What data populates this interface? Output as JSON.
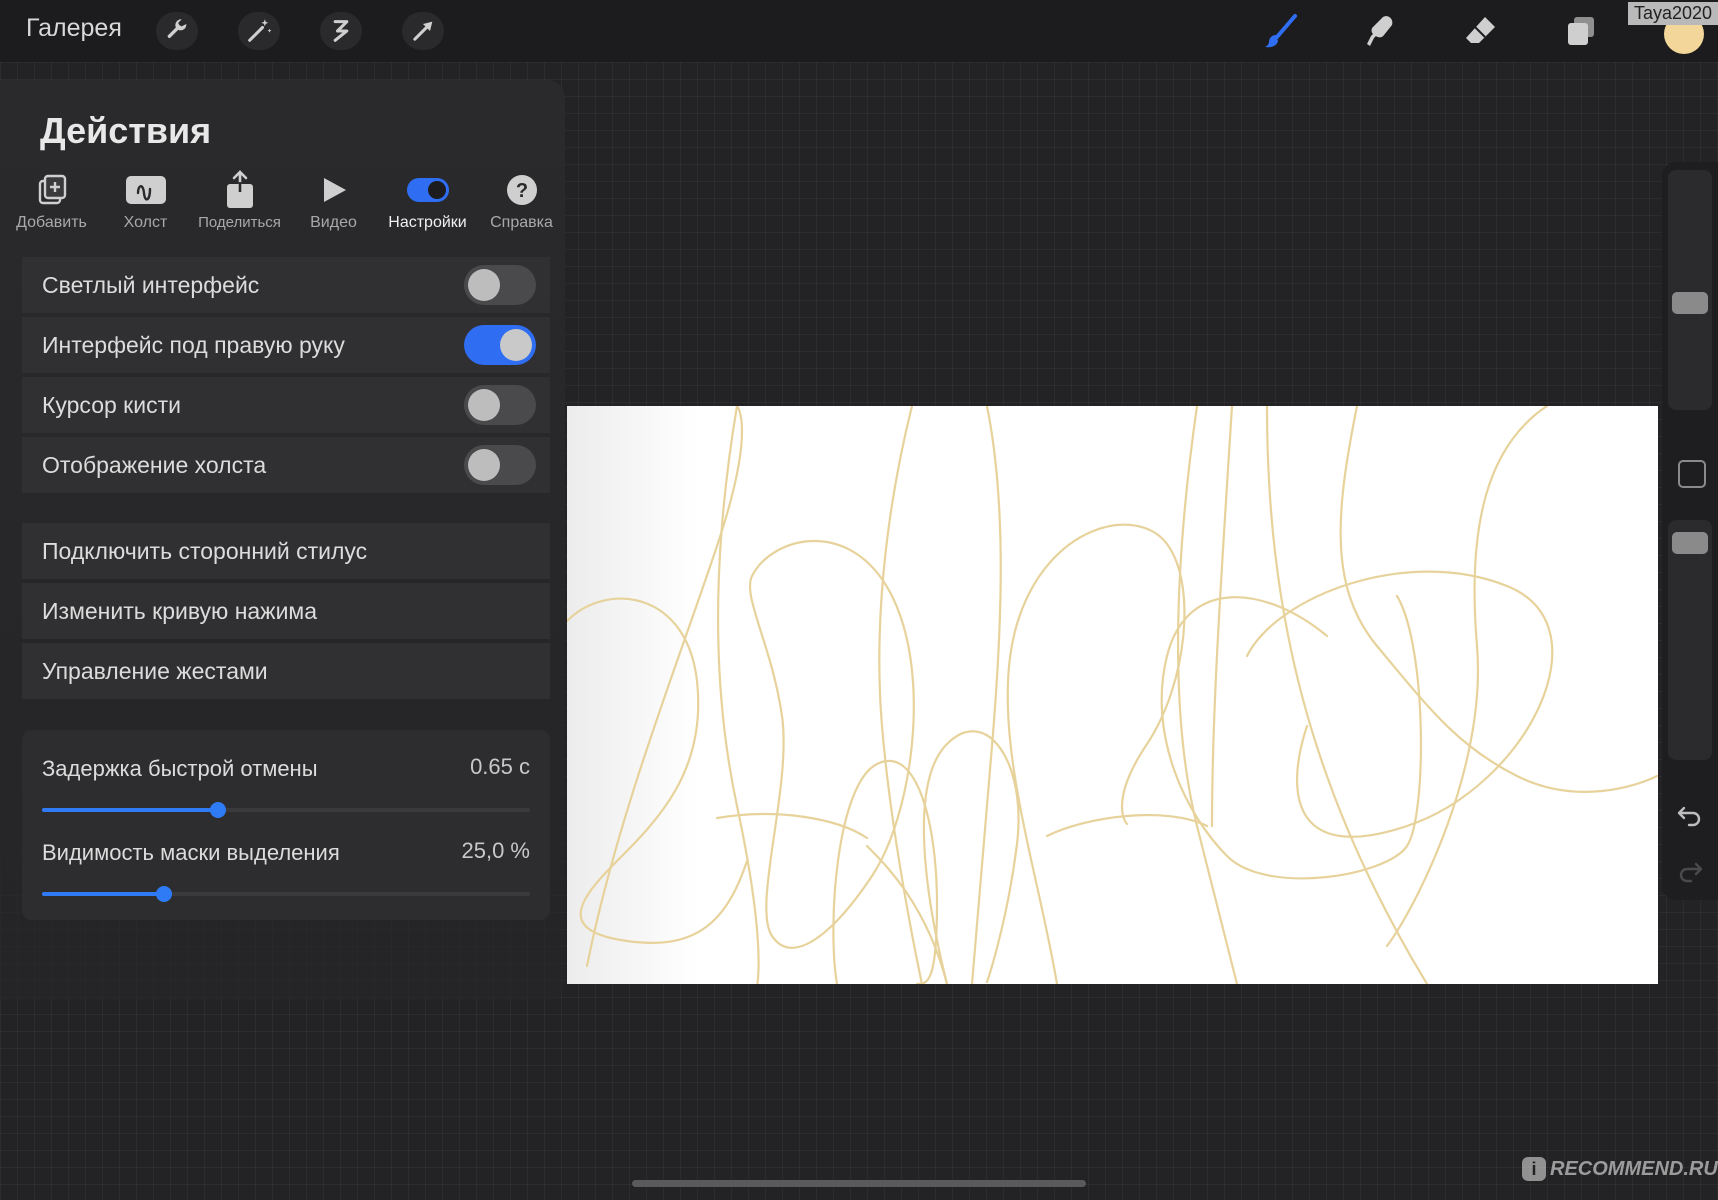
{
  "topbar": {
    "gallery_label": "Галерея",
    "username": "Taya2020",
    "left_icons": [
      "wrench-icon",
      "magic-wand-icon",
      "selection-icon",
      "transform-arrow-icon"
    ],
    "right_icons": [
      "brush-icon",
      "smudge-icon",
      "eraser-icon",
      "layers-icon"
    ],
    "current_color": "#f3d79a"
  },
  "panel": {
    "title": "Действия",
    "tabs": [
      {
        "label": "Добавить",
        "icon": "add-icon"
      },
      {
        "label": "Холст",
        "icon": "canvas-icon"
      },
      {
        "label": "Поделиться",
        "icon": "share-icon"
      },
      {
        "label": "Видео",
        "icon": "play-icon"
      },
      {
        "label": "Настройки",
        "icon": "toggle-icon",
        "active": true
      },
      {
        "label": "Справка",
        "icon": "help-icon"
      }
    ],
    "toggles": [
      {
        "label": "Светлый интерфейс",
        "on": false
      },
      {
        "label": "Интерфейс под правую руку",
        "on": true
      },
      {
        "label": "Курсор кисти",
        "on": false
      },
      {
        "label": "Отображение холста",
        "on": false
      }
    ],
    "links": [
      {
        "label": "Подключить сторонний стилус"
      },
      {
        "label": "Изменить кривую нажима"
      },
      {
        "label": "Управление жестами"
      }
    ],
    "sliders": [
      {
        "label": "Задержка быстрой отмены",
        "value": "0.65 с",
        "fraction": 0.36
      },
      {
        "label": "Видимость маски выделения",
        "value": "25,0 %",
        "fraction": 0.25
      }
    ]
  },
  "accent_color": "#2f6ef2",
  "stroke_color": "#e6d29a",
  "watermark": "RECOMMEND.RU"
}
